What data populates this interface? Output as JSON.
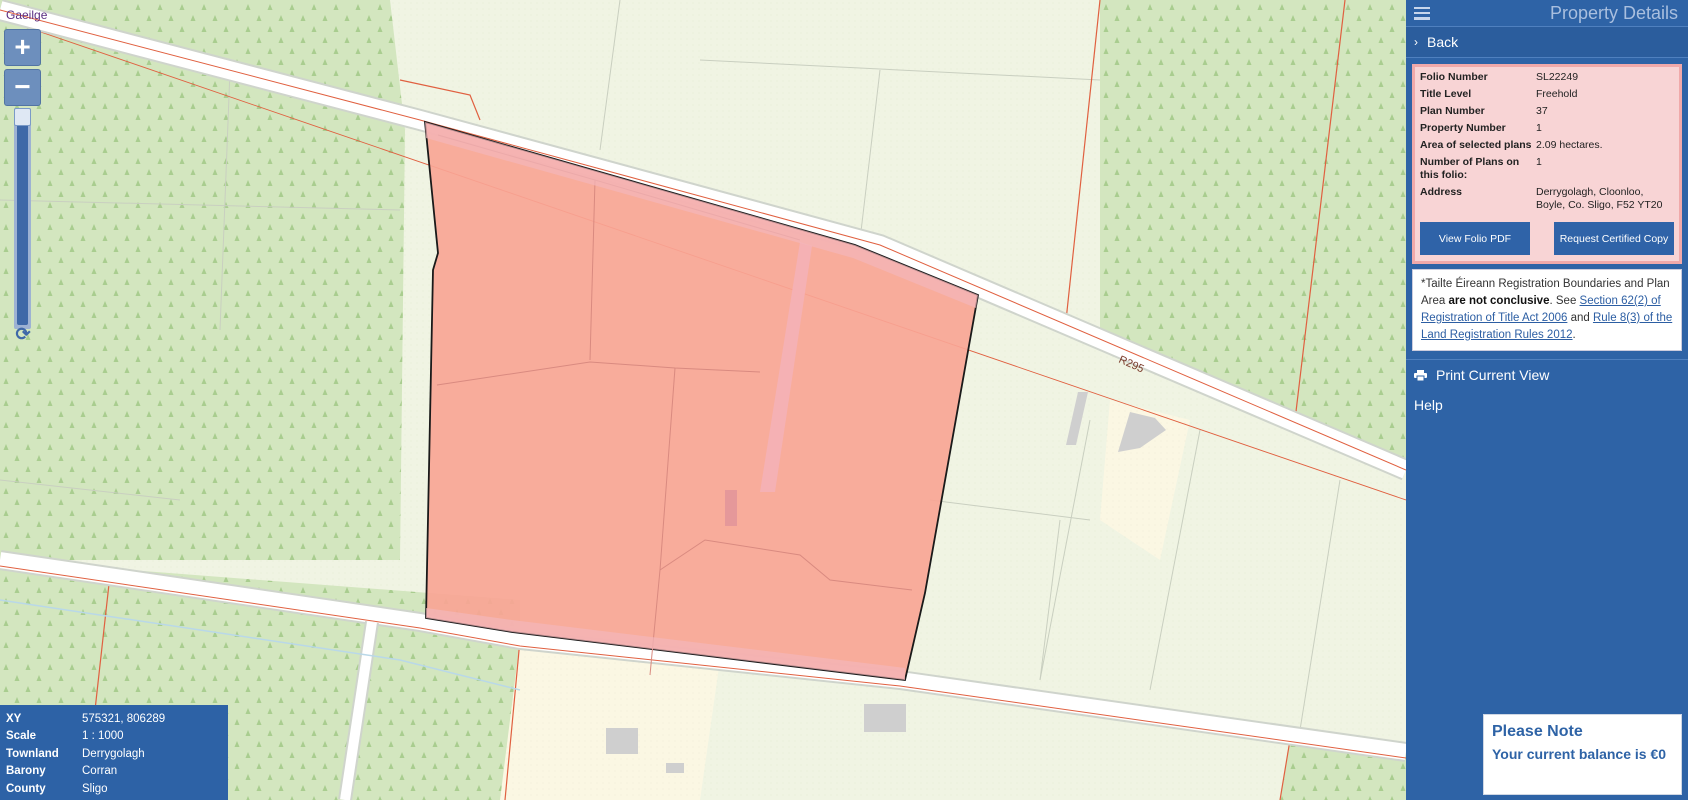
{
  "map": {
    "lang_link": "Gaeilge",
    "road_label": "R295",
    "zoom_in": "+",
    "zoom_out": "−",
    "refresh_icon": "refresh-icon",
    "colors": {
      "forest": "#d2e6bd",
      "field": "#eef3e2",
      "property_fill": "#f8a89a",
      "road": "#ffffff",
      "boundary_red": "#e05a3a"
    }
  },
  "info_box": {
    "rows": [
      {
        "key": "XY",
        "value": "575321, 806289"
      },
      {
        "key": "Scale",
        "value": "1 : 1000"
      },
      {
        "key": "Townland",
        "value": "Derrygolagh"
      },
      {
        "key": "Barony",
        "value": "Corran"
      },
      {
        "key": "County",
        "value": "Sligo"
      }
    ]
  },
  "panel": {
    "title": "Property Details",
    "back_label": "Back",
    "details": [
      {
        "key": "Folio Number",
        "value": "SL22249"
      },
      {
        "key": "Title Level",
        "value": "Freehold"
      },
      {
        "key": "Plan Number",
        "value": "37"
      },
      {
        "key": "Property Number",
        "value": "1"
      },
      {
        "key": "Area of selected plans",
        "value": "2.09 hectares."
      },
      {
        "key": "Number of Plans on this folio:",
        "value": "1"
      },
      {
        "key": "Address",
        "value": "Derrygolagh, Cloonloo, Boyle, Co. Sligo, F52 YT20"
      }
    ],
    "view_folio_button": "View Folio PDF",
    "certified_copy_button": "Request Certified Copy",
    "disclaimer": {
      "prefix": "*Tailte Éireann Registration Boundaries and Plan Area ",
      "bold": "are not conclusive",
      "middle": ". See ",
      "link1": "Section 62(2) of Registration of Title Act 2006",
      "and": " and ",
      "link2": "Rule 8(3) of the Land Registration Rules 2012",
      "suffix": "."
    },
    "print_label": "Print Current View",
    "help_label": "Help"
  },
  "note": {
    "title": "Please Note",
    "text": "Your current balance is €0"
  }
}
